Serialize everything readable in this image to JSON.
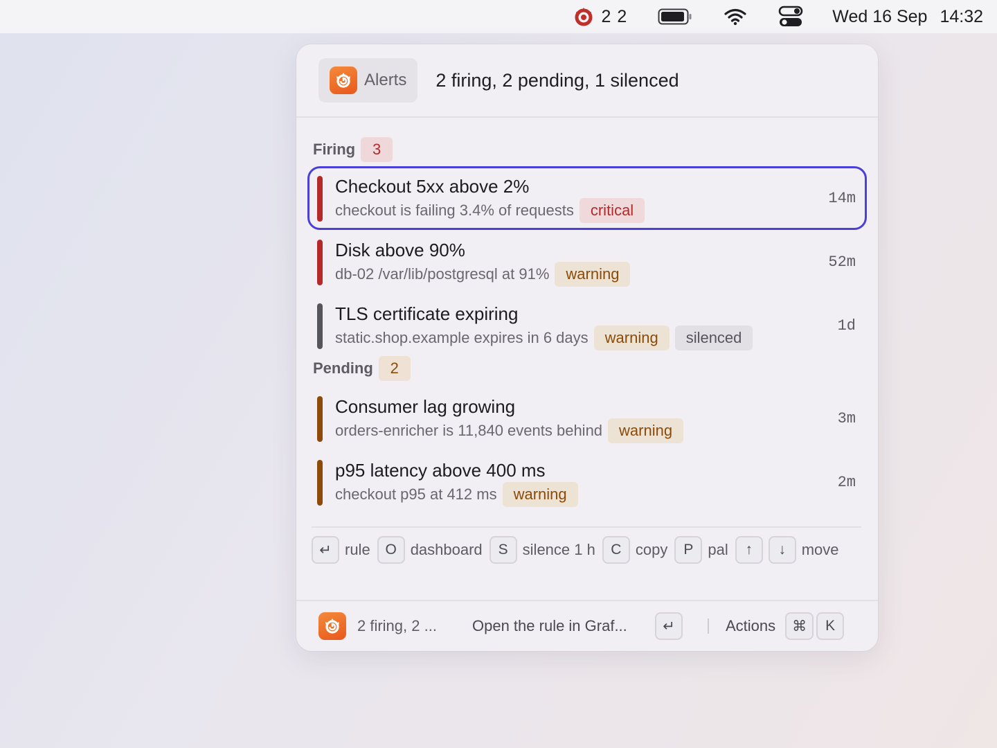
{
  "menubar": {
    "grafana_counts": "2 2",
    "date": "Wed 16 Sep",
    "time": "14:32",
    "icons": [
      "grafana-icon",
      "battery-icon",
      "wifi-icon",
      "control-center-icon"
    ]
  },
  "header": {
    "app_label": "Alerts",
    "summary": "2 firing, 2 pending, 1 silenced"
  },
  "sections": {
    "firing": {
      "title": "Firing",
      "count": "3"
    },
    "pending": {
      "title": "Pending",
      "count": "2"
    }
  },
  "alerts": [
    {
      "title": "Checkout 5xx above 2%",
      "subtitle": "checkout is failing 3.4% of requests",
      "tags": [
        "critical"
      ],
      "age": "14m",
      "severity_color": "#b42a2a",
      "selected": true
    },
    {
      "title": "Disk above 90%",
      "subtitle": "db-02 /var/lib/postgresql at 91%",
      "tags": [
        "warning"
      ],
      "age": "52m",
      "severity_color": "#b42a2a"
    },
    {
      "title": "TLS certificate expiring",
      "subtitle": "static.shop.example expires in 6 days",
      "tags": [
        "warning",
        "silenced"
      ],
      "age": "1d",
      "severity_color": "#57555c"
    },
    {
      "title": "Consumer lag growing",
      "subtitle": "orders-enricher is 11,840 events behind",
      "tags": [
        "warning"
      ],
      "age": "3m",
      "severity_color": "#8e4a08"
    },
    {
      "title": "p95 latency above 400 ms",
      "subtitle": "checkout p95 at 412 ms",
      "tags": [
        "warning"
      ],
      "age": "2m",
      "severity_color": "#8e4a08"
    }
  ],
  "hints": {
    "enter_key": "↵",
    "rule": "rule",
    "o_key": "O",
    "dashboard": "dashboard",
    "s_key": "S",
    "silence": "silence 1 h",
    "c_key": "C",
    "copy": "copy",
    "p_key": "P",
    "pal": "pal",
    "up_key": "↑",
    "down_key": "↓",
    "move": "move"
  },
  "footer": {
    "summary": "2 firing, 2 ...",
    "primary_action": "Open the rule in Graf...",
    "enter_key": "↵",
    "actions": "Actions",
    "cmd_key": "⌘",
    "k_key": "K"
  },
  "colors": {
    "accent": "#4a3fd6",
    "critical": "#b32a2a",
    "warning": "#8a4a0a",
    "grafana_orange": "#e8581c"
  }
}
